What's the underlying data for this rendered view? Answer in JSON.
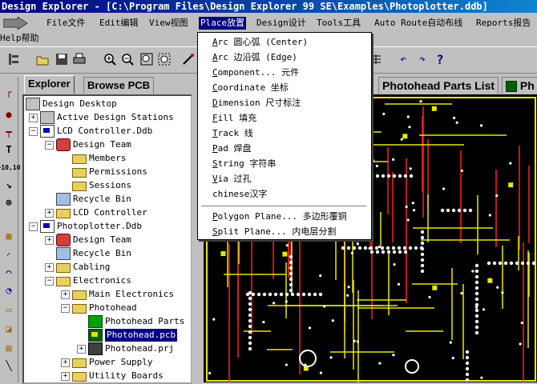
{
  "window": {
    "title": "Design Explorer - [C:\\Program Files\\Design Explorer 99 SE\\Examples\\Photoplotter.ddb]"
  },
  "menubar": {
    "items": [
      {
        "label": "File文件"
      },
      {
        "label": "Edit编辑"
      },
      {
        "label": "View视图"
      },
      {
        "label": "Place放置"
      },
      {
        "label": "Design设计"
      },
      {
        "label": "Tools工具"
      },
      {
        "label": "Auto Route自动布线"
      },
      {
        "label": "Reports报告"
      }
    ],
    "help": "Help帮助"
  },
  "place_menu": {
    "items": [
      {
        "key": "A",
        "rest": "rc 圆心弧 (Center)"
      },
      {
        "key": "A",
        "rest": "rc 边沿弧 (Edge)"
      },
      {
        "key": "C",
        "rest": "omponent... 元件"
      },
      {
        "key": "C",
        "rest": "oordinate 坐标"
      },
      {
        "key": "D",
        "rest": "imension 尺寸标注"
      },
      {
        "key": "F",
        "rest": "ill 填充"
      },
      {
        "key": "T",
        "rest": "rack 线"
      },
      {
        "key": "P",
        "rest": "ad 焊盘"
      },
      {
        "key": "S",
        "rest": "tring 字符串"
      },
      {
        "key": "V",
        "rest": "ia 过孔"
      },
      {
        "key": "",
        "rest": "chinese汉字"
      },
      {
        "key": "P",
        "rest": "olygon Plane... 多边形覆铜"
      },
      {
        "key": "S",
        "rest": "plit Plane... 内电层分割"
      }
    ]
  },
  "explorer": {
    "tabs": [
      "Explorer",
      "Browse PCB"
    ],
    "tree": [
      {
        "label": "Design Desktop",
        "icon": "desktop-icon"
      },
      {
        "label": "Active Design Stations",
        "icon": "desktop-icon"
      },
      {
        "label": "LCD Controller.Ddb",
        "icon": "database-icon"
      },
      {
        "label": "Design Team",
        "icon": "team-icon"
      },
      {
        "label": "Members",
        "icon": "folder-icon"
      },
      {
        "label": "Permissions",
        "icon": "folder-icon"
      },
      {
        "label": "Sessions",
        "icon": "folder-icon"
      },
      {
        "label": "Recycle Bin",
        "icon": "recycle-bin-icon"
      },
      {
        "label": "LCD Controller",
        "icon": "folder-icon"
      },
      {
        "label": "Photoplotter.Ddb",
        "icon": "database-icon"
      },
      {
        "label": "Design Team",
        "icon": "team-icon"
      },
      {
        "label": "Recycle Bin",
        "icon": "recycle-bin-icon"
      },
      {
        "label": "Cabling",
        "icon": "folder-icon"
      },
      {
        "label": "Electronics",
        "icon": "folder-icon"
      },
      {
        "label": "Main Electronics",
        "icon": "folder-icon"
      },
      {
        "label": "Photohead",
        "icon": "folder-icon"
      },
      {
        "label": "Photohead Parts",
        "icon": "netlist-icon"
      },
      {
        "label": "Photohead.pcb",
        "icon": "pcb-icon"
      },
      {
        "label": "Photohead.prj",
        "icon": "project-icon"
      },
      {
        "label": "Power Supply",
        "icon": "folder-icon"
      },
      {
        "label": "Utility Boards",
        "icon": "folder-icon"
      }
    ]
  },
  "document_tabs": [
    "Photohead Parts List",
    "Ph"
  ],
  "colors": {
    "selection": "#000080",
    "pcb_background": "#000000",
    "track_yellow": "#e8e800",
    "track_red": "#ff2020",
    "pad_white": "#ffffff"
  }
}
